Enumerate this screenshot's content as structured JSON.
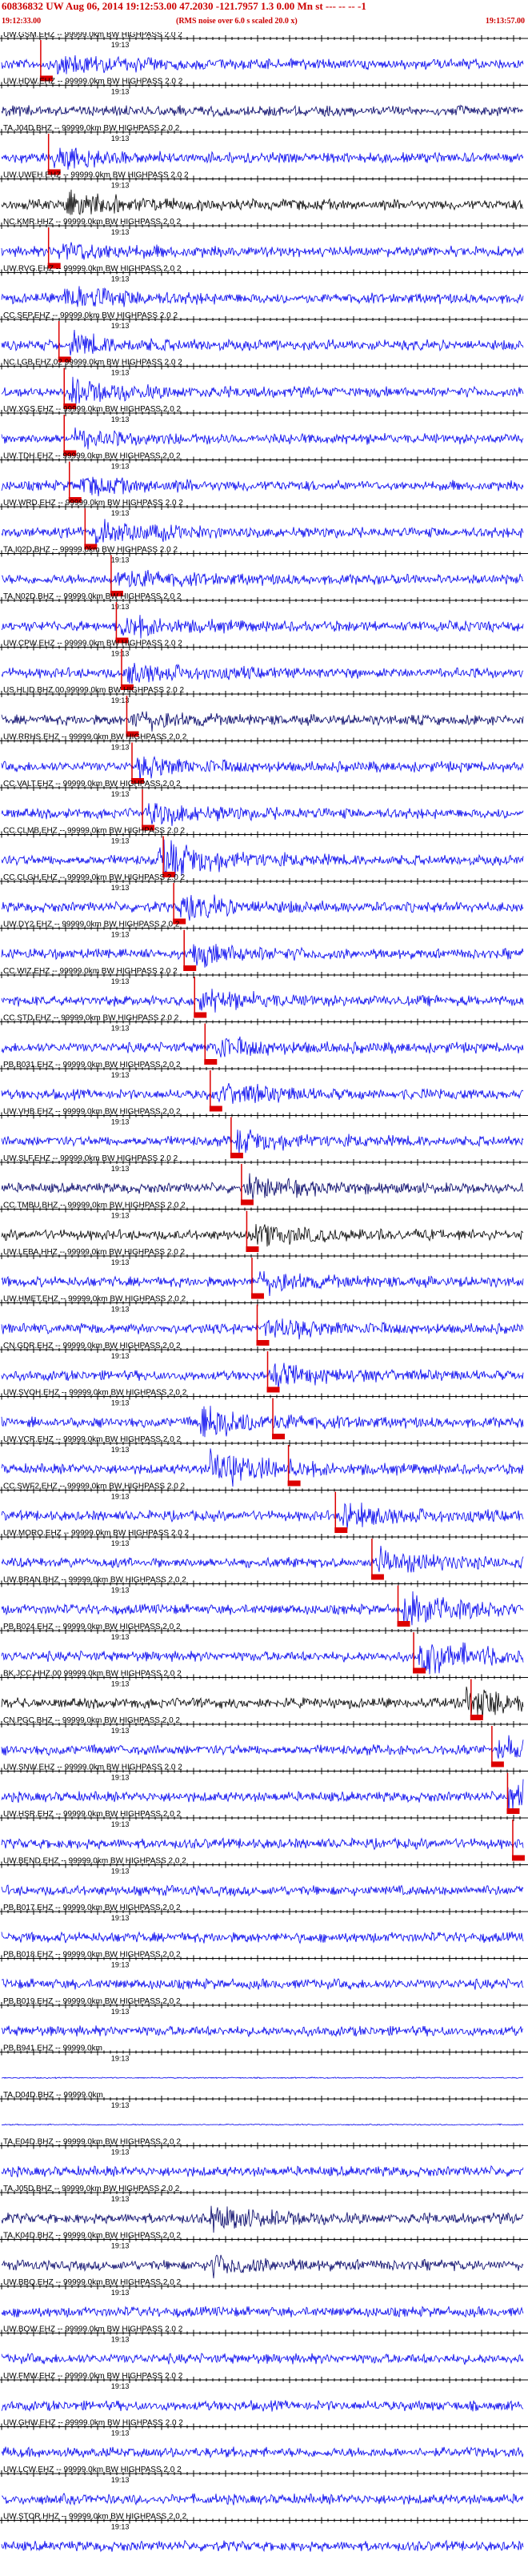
{
  "header": {
    "title": "60836832 UW Aug 06, 2014 19:12:53.00    47.2030 -121.7957   1.3 0.00 Mn st --- -- -- -1",
    "start_time": "19:12:33.00",
    "subtitle": "(RMS noise over 6.0 s scaled 20.0 x)",
    "end_time": "19:13:57.00"
  },
  "colors": {
    "header_text": "#cc0000",
    "trace_blue": "#0000ee",
    "trace_dark": "#000066",
    "trace_black": "#000000",
    "pick_marker": "#dd0000",
    "axis": "#000000"
  },
  "chart_data": {
    "type": "seismogram",
    "x_range": [
      "19:12:33.00",
      "19:13:57.00"
    ],
    "time_tick_label": "19:13",
    "channels": [
      {
        "label": "UW.GSM.EHZ -- 99999.0km BW  HIGHPASS  2.0  2",
        "pick": 0.075,
        "onset": 0.1,
        "burst": 0.6,
        "color": "blue"
      },
      {
        "label": "UW.HDW.EHZ -- 99999.0km BW  HIGHPASS  2.0  2",
        "pick": null,
        "onset": null,
        "burst": 0.6,
        "color": "dark"
      },
      {
        "label": "TA.J04D.BHZ -- 99999.0km BW  HIGHPASS  2.0  2",
        "pick": 0.09,
        "onset": 0.1,
        "burst": 0.5,
        "color": "blue"
      },
      {
        "label": "UW.UWEH.EHZ -- 99999.0km BW  HIGHPASS  2.0  2",
        "pick": null,
        "onset": 0.12,
        "burst": 0.6,
        "color": "black"
      },
      {
        "label": "NC.KMR.HHZ -- 99999.0km BW  HIGHPASS  2.0  2",
        "pick": 0.09,
        "onset": 0.11,
        "burst": 0.5,
        "color": "blue"
      },
      {
        "label": "UW.RVG.EHZ -- 99999.0km BW  HIGHPASS  2.0  2",
        "pick": null,
        "onset": 0.12,
        "burst": 0.6,
        "color": "blue"
      },
      {
        "label": "CC.SEP.EHZ -- 99999.0km BW  HIGHPASS  2.0  2",
        "pick": 0.11,
        "onset": 0.13,
        "burst": 0.5,
        "color": "blue"
      },
      {
        "label": "NC.LGB.EHZ.02 99999.0km BW  HIGHPASS  2.0  2",
        "pick": 0.12,
        "onset": 0.13,
        "burst": 0.6,
        "color": "blue"
      },
      {
        "label": "UW.XGS.EHZ -- 99999.0km BW  HIGHPASS  2.0  2",
        "pick": 0.12,
        "onset": 0.14,
        "burst": 0.4,
        "color": "blue"
      },
      {
        "label": "UW.TDH.EHZ -- 99999.0km BW  HIGHPASS  2.0  2",
        "pick": 0.13,
        "onset": 0.15,
        "burst": 0.4,
        "color": "blue"
      },
      {
        "label": "UW.WRD.EHZ -- 99999.0km BW  HIGHPASS  2.0  2",
        "pick": 0.16,
        "onset": 0.18,
        "burst": 0.7,
        "color": "blue"
      },
      {
        "label": "TA.I02D.BHZ -- 99999.0km BW  HIGHPASS  2.0  2",
        "pick": 0.21,
        "onset": 0.22,
        "burst": 0.5,
        "color": "blue"
      },
      {
        "label": "TA.N02D.BHZ -- 99999.0km BW  HIGHPASS  2.0  2",
        "pick": 0.22,
        "onset": 0.23,
        "burst": 0.5,
        "color": "blue"
      },
      {
        "label": "UW.CPW.EHZ -- 99999.0km BW  HIGHPASS  2.0  2",
        "pick": 0.23,
        "onset": 0.24,
        "burst": 0.5,
        "color": "blue"
      },
      {
        "label": "US.HLID.BHZ.00 99999.0km BW  HIGHPASS  2.0  2",
        "pick": 0.24,
        "onset": 0.25,
        "burst": 0.4,
        "color": "dark"
      },
      {
        "label": "UW.RRHS.EHZ -- 99999.0km BW  HIGHPASS  2.0  2",
        "pick": 0.25,
        "onset": 0.26,
        "burst": 0.5,
        "color": "blue"
      },
      {
        "label": "CC.VALT.EHZ -- 99999.0km BW  HIGHPASS  2.0  2",
        "pick": 0.27,
        "onset": 0.28,
        "burst": 0.6,
        "color": "blue"
      },
      {
        "label": "CC.CLMB.EHZ -- 99999.0km BW  HIGHPASS  2.0  2",
        "pick": 0.31,
        "onset": 0.3,
        "burst": 1.0,
        "color": "blue"
      },
      {
        "label": "CC.CLGH.EHZ -- 99999.0km BW  HIGHPASS  2.0  2",
        "pick": 0.33,
        "onset": 0.34,
        "burst": 0.6,
        "color": "blue"
      },
      {
        "label": "UW.DY2.EHZ -- 99999.0km BW  HIGHPASS  2.0  2",
        "pick": 0.35,
        "onset": 0.36,
        "burst": 0.5,
        "color": "blue"
      },
      {
        "label": "CC.WIZ.EHZ -- 99999.0km BW  HIGHPASS  2.0  2",
        "pick": 0.37,
        "onset": 0.38,
        "burst": 0.5,
        "color": "blue"
      },
      {
        "label": "CC.STD.EHZ -- 99999.0km BW  HIGHPASS  2.0  2",
        "pick": 0.39,
        "onset": 0.4,
        "burst": 0.5,
        "color": "blue"
      },
      {
        "label": "PB.B031.EHZ -- 99999.0km BW  HIGHPASS  2.0  2",
        "pick": 0.4,
        "onset": 0.41,
        "burst": 0.5,
        "color": "blue"
      },
      {
        "label": "UW.VHB.EHZ -- 99999.0km BW  HIGHPASS  2.0  2",
        "pick": 0.44,
        "onset": 0.45,
        "burst": 0.5,
        "color": "blue"
      },
      {
        "label": "UW.SLF.EHZ -- 99999.0km BW  HIGHPASS  2.0  2",
        "pick": 0.46,
        "onset": 0.47,
        "burst": 0.5,
        "color": "dark"
      },
      {
        "label": "CC.TMBU.BHZ -- 99999.0km BW  HIGHPASS  2.0  2",
        "pick": 0.47,
        "onset": 0.48,
        "burst": 0.5,
        "color": "black"
      },
      {
        "label": "UW.LEBA.HHZ -- 99999.0km BW  HIGHPASS  2.0  2",
        "pick": 0.48,
        "onset": 0.49,
        "burst": 0.5,
        "color": "blue"
      },
      {
        "label": "UW.HMET.EHZ -- 99999.0km BW  HIGHPASS  2.0  2",
        "pick": 0.49,
        "onset": 0.5,
        "burst": 0.5,
        "color": "blue"
      },
      {
        "label": "CN.GDR.EHZ -- 99999.0km BW  HIGHPASS  2.0  2",
        "pick": 0.51,
        "onset": 0.52,
        "burst": 0.5,
        "color": "blue"
      },
      {
        "label": "UW.SVOH.EHZ -- 99999.0km BW  HIGHPASS  2.0  2",
        "pick": 0.52,
        "onset": 0.38,
        "burst": 1.0,
        "color": "blue"
      },
      {
        "label": "UW.VCR.EHZ -- 99999.0km BW  HIGHPASS  2.0  2",
        "pick": 0.55,
        "onset": 0.4,
        "burst": 1.0,
        "color": "blue"
      },
      {
        "label": "CC.SWF2.EHZ -- 99999.0km BW  HIGHPASS  2.0  2",
        "pick": 0.64,
        "onset": 0.65,
        "burst": 0.6,
        "color": "blue"
      },
      {
        "label": "UW.MORO.EHZ -- 99999.0km BW  HIGHPASS  2.0  2",
        "pick": 0.71,
        "onset": 0.72,
        "burst": 0.6,
        "color": "blue"
      },
      {
        "label": "UW.BRAN.BHZ -- 99999.0km BW  HIGHPASS  2.0  2",
        "pick": 0.76,
        "onset": 0.77,
        "burst": 0.9,
        "color": "blue"
      },
      {
        "label": "PB.B024.EHZ -- 99999.0km BW  HIGHPASS  2.0  2",
        "pick": 0.79,
        "onset": 0.8,
        "burst": 1.0,
        "color": "blue"
      },
      {
        "label": "BK.JCC.HHZ.00 99999.0km BW  HIGHPASS  2.0  2",
        "pick": 0.9,
        "onset": 0.89,
        "burst": 0.9,
        "color": "black"
      },
      {
        "label": "CN.PGC.BHZ -- 99999.0km BW  HIGHPASS  2.0  2",
        "pick": 0.94,
        "onset": 0.95,
        "burst": 0.5,
        "color": "blue"
      },
      {
        "label": "UW.SNW.EHZ -- 99999.0km BW  HIGHPASS  2.0  2",
        "pick": 0.97,
        "onset": 0.97,
        "burst": 0.8,
        "color": "blue"
      },
      {
        "label": "UW.HSR.EHZ -- 99999.0km BW  HIGHPASS  2.0  2",
        "pick": 0.98,
        "onset": null,
        "burst": 0.5,
        "color": "blue"
      },
      {
        "label": "UW.BEND.EHZ -- 99999.0km BW  HIGHPASS  2.0  2",
        "pick": null,
        "onset": null,
        "burst": 0.5,
        "color": "blue"
      },
      {
        "label": "PB.B017.EHZ -- 99999.0km BW  HIGHPASS  2.0  2",
        "pick": null,
        "onset": null,
        "burst": 0.5,
        "color": "blue"
      },
      {
        "label": "PB.B018.EHZ -- 99999.0km BW  HIGHPASS  2.0  2",
        "pick": null,
        "onset": null,
        "burst": 0.5,
        "color": "blue"
      },
      {
        "label": "PB.B019.EHZ -- 99999.0km BW  HIGHPASS  2.0  2",
        "pick": null,
        "onset": null,
        "burst": 0.5,
        "color": "blue"
      },
      {
        "label": "PB.B941.EHZ -- 99999.0km",
        "pick": null,
        "onset": null,
        "burst": 0.0,
        "color": "blue"
      },
      {
        "label": "TA.D04D.BHZ -- 99999.0km",
        "pick": null,
        "onset": null,
        "burst": 0.0,
        "color": "blue"
      },
      {
        "label": "TA.E04D.BHZ -- 99999.0km BW  HIGHPASS  2.0  2",
        "pick": null,
        "onset": null,
        "burst": 0.5,
        "color": "blue"
      },
      {
        "label": "TA.J05D.BHZ -- 99999.0km BW  HIGHPASS  2.0  2",
        "pick": null,
        "onset": 0.4,
        "burst": 0.6,
        "color": "dark"
      },
      {
        "label": "TA.K04D.BHZ -- 99999.0km BW  HIGHPASS  2.0  2",
        "pick": null,
        "onset": 0.4,
        "burst": 0.5,
        "color": "dark"
      },
      {
        "label": "UW.BBQ.EHZ -- 99999.0km BW  HIGHPASS  2.0  2",
        "pick": null,
        "onset": null,
        "burst": 0.5,
        "color": "blue"
      },
      {
        "label": "UW.BOW.EHZ -- 99999.0km BW  HIGHPASS  2.0  2",
        "pick": null,
        "onset": null,
        "burst": 0.5,
        "color": "blue"
      },
      {
        "label": "UW.FMW.EHZ -- 99999.0km BW  HIGHPASS  2.0  2",
        "pick": null,
        "onset": null,
        "burst": 0.5,
        "color": "blue"
      },
      {
        "label": "UW.GHW.EHZ -- 99999.0km BW  HIGHPASS  2.0  2",
        "pick": null,
        "onset": null,
        "burst": 0.5,
        "color": "blue"
      },
      {
        "label": "UW.LCW.EHZ -- 99999.0km BW  HIGHPASS  2.0  2",
        "pick": null,
        "onset": null,
        "burst": 0.5,
        "color": "blue"
      },
      {
        "label": "UW.STOR.HHZ -- 99999.0km BW  HIGHPASS  2.0  2",
        "pick": null,
        "onset": null,
        "burst": 0.5,
        "color": "blue"
      }
    ]
  }
}
